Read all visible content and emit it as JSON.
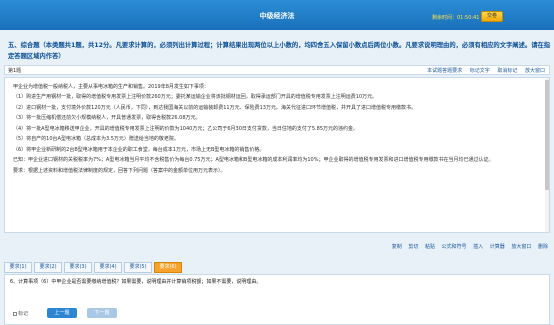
{
  "header": {
    "title": "中级经济法",
    "timer_label": "剩余时间：01:50:41",
    "submit_label": "交卷"
  },
  "section": {
    "title": "五、综合题（本类题共1题，共12分。凡要求计算的，必须列出计算过程；计算结果出现两位以上小数的，均四舍五入保留小数点后两位小数。凡要求说明理由的，必须有相应的文字阐述。请在指定答题区域内作答）"
  },
  "question_bar": {
    "number": "第1题",
    "tools": [
      "本试题答题要求",
      "标记文字",
      "取消标记",
      "放大窗口"
    ]
  },
  "material": {
    "intro": "甲企业为增值税一般纳税人，主要从事电冰箱的生产和销售。2019年8月发生如下事项：",
    "items": [
      "（1）购进生产用钢材一批，取得的增值税专用发票上注明价款260万元；委托某运输企业将该批钢材运回，取得承运部门开具的增值税专用发票上注明运费10万元。",
      "（2）进口钢材一批，支付境外价款120万元（人民币，下同），到达我国海关以前的运输装卸费11万元、保险费13万元。海关代征进口环节增值税，并开具了进口增值税专用缴款书。",
      "（3）将一批压缩机偿还前欠小规模纳税人，开具普通发票，取得含税款26.08万元。",
      "（4）将一批A型电冰箱移送甲企业，开具的增值税专用发票上注明的价款为1040万元；乙公司于6月30日支付货款，当日住地的支付了5.85万元的违约金。",
      "（5）将自产的10台A型电冰箱（总成本为3.5万元）赠送给当地的敬老院。",
      "（6）将甲企业新研制的2台B型电冰箱用于本企业的职工食堂，每台成本1万元，市场上无B型电冰箱的销售价格。",
      "已知：甲企业进口钢材的关税税率为7%；A型电冰箱当月平均不含税售价为每台0.75万元；A型电冰箱和B型电冰箱的成本利润率均为10%；甲企业取得的增值税专用发票和进口增值税专用缴款书在当月均已通过认证。",
      "要求：根据上述资料和增值税法律制度的规定，回答下列问题（答案中的金额单位用万元表示）。"
    ]
  },
  "toolbar2": {
    "tools": [
      "复制",
      "剪切",
      "粘贴",
      "公式和符号",
      "插入",
      "计算器",
      "放大窗口",
      "删除"
    ]
  },
  "tabs": [
    "要求(1)",
    "要求(2)",
    "要求(3)",
    "要求(4)",
    "要求(5)",
    "要求(6)"
  ],
  "active_tab_index": 5,
  "answer": {
    "question": "6、计算事项（6）中甲企业是否需要缴纳增值税？如果需要，说明理由并计算销项税额；如果不需要，说明理由。",
    "mark_label": "标记",
    "prev_label": "上一题",
    "next_label": "下一题"
  },
  "colors": {
    "header_blue": "#1a6fba",
    "active_tab": "#f7a32b",
    "timer": "#ffe44d"
  }
}
